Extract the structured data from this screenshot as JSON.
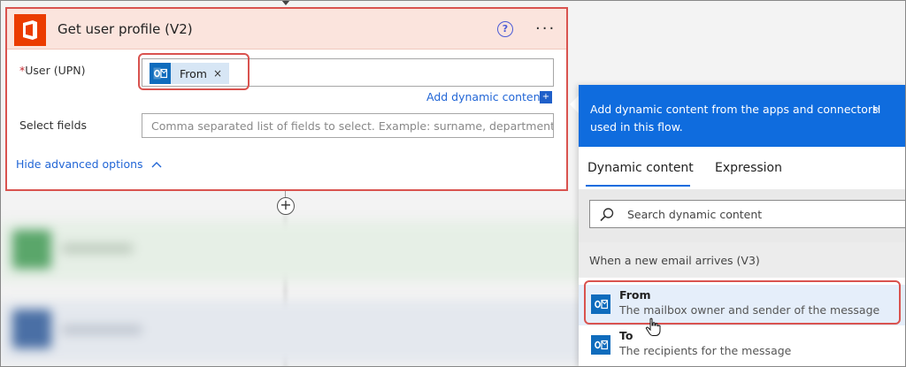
{
  "card": {
    "title": "Get user profile (V2)",
    "help_glyph": "?",
    "more_glyph": "···",
    "user_label": "User (UPN)",
    "required_mark": "*",
    "token_label": "From",
    "token_remove": "×",
    "add_dynamic": "Add dynamic content",
    "select_fields_label": "Select fields",
    "select_fields_placeholder": "Comma separated list of fields to select. Example: surname, department, jobTitl",
    "hide_advanced": "Hide advanced options"
  },
  "panel": {
    "header_line1": "Add dynamic content from the apps and connectors",
    "header_line2": "used in this flow.",
    "header_extra": "H",
    "tabs": [
      {
        "label": "Dynamic content",
        "active": true
      },
      {
        "label": "Expression",
        "active": false
      }
    ],
    "search_placeholder": "Search dynamic content",
    "section_title": "When a new email arrives (V3)",
    "items": [
      {
        "name": "From",
        "desc": "The mailbox owner and sender of the message",
        "highlighted": true
      },
      {
        "name": "To",
        "desc": "The recipients for the message",
        "highlighted": false
      }
    ]
  },
  "colors": {
    "accent_blue": "#0f6cde",
    "highlight_red": "#d9534f",
    "office_orange": "#eb3c00",
    "card_header": "#fbe4dd"
  },
  "icons": [
    "office-icon",
    "outlook-icon",
    "help-icon",
    "more-icon",
    "search-icon",
    "chevron-up-icon",
    "plus-icon",
    "hand-cursor-icon"
  ]
}
